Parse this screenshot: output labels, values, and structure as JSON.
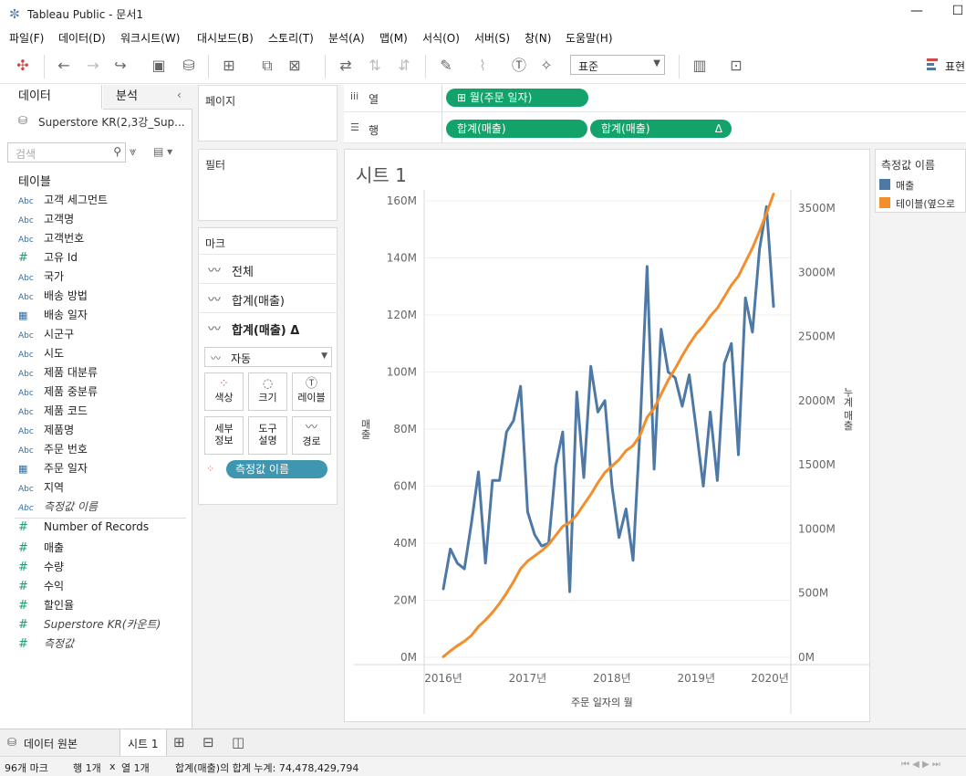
{
  "window": {
    "title": "Tableau Public - 문서1",
    "minimize": "—",
    "maximize": "☐"
  },
  "menu": [
    "파일(F)",
    "데이터(D)",
    "워크시트(W)",
    "대시보드(B)",
    "스토리(T)",
    "분석(A)",
    "맵(M)",
    "서식(O)",
    "서버(S)",
    "창(N)",
    "도움말(H)"
  ],
  "toolbar": {
    "fit_value": "표준",
    "show_me": "표현"
  },
  "data_pane": {
    "tab_data": "데이터",
    "tab_analysis": "분석",
    "datasource": "Superstore KR(2,3강_Sup...",
    "search_placeholder": "검색",
    "tables_header": "테이블",
    "dimensions": [
      {
        "type": "Abc",
        "name": "고객 세그먼트"
      },
      {
        "type": "Abc",
        "name": "고객명"
      },
      {
        "type": "Abc",
        "name": "고객번호"
      },
      {
        "type": "#",
        "name": "고유 Id"
      },
      {
        "type": "Abc",
        "name": "국가"
      },
      {
        "type": "Abc",
        "name": "배송 방법"
      },
      {
        "type": "cal",
        "name": "배송 일자"
      },
      {
        "type": "Abc",
        "name": "시군구"
      },
      {
        "type": "Abc",
        "name": "시도"
      },
      {
        "type": "Abc",
        "name": "제품 대분류"
      },
      {
        "type": "Abc",
        "name": "제품 중분류"
      },
      {
        "type": "Abc",
        "name": "제품 코드"
      },
      {
        "type": "Abc",
        "name": "제품명"
      },
      {
        "type": "Abc",
        "name": "주문 번호"
      },
      {
        "type": "cal",
        "name": "주문 일자"
      },
      {
        "type": "Abc",
        "name": "지역"
      },
      {
        "type": "Abc",
        "name": "측정값 이름",
        "italic": true
      }
    ],
    "measures": [
      {
        "type": "#",
        "name": "Number of Records"
      },
      {
        "type": "#",
        "name": "매출"
      },
      {
        "type": "#",
        "name": "수량"
      },
      {
        "type": "#",
        "name": "수익"
      },
      {
        "type": "#",
        "name": "할인율"
      },
      {
        "type": "#",
        "name": "Superstore KR(카운트)",
        "italic": true
      },
      {
        "type": "#",
        "name": "측정값",
        "italic": true
      }
    ]
  },
  "cards": {
    "pages": "페이지",
    "filters": "필터",
    "marks": "마크",
    "marks_rows": [
      "전체",
      "합계(매출)",
      "합계(매출) Δ"
    ],
    "mark_type": "자동",
    "mark_buttons": [
      "색상",
      "크기",
      "레이블",
      "세부\n정보",
      "도구\n설명",
      "경로"
    ],
    "mark_pill": "측정값 이름"
  },
  "shelves": {
    "columns_label": "열",
    "rows_label": "행",
    "columns_pill": "월(주문 일자)",
    "rows_pill_1": "합계(매출)",
    "rows_pill_2": "합계(매출)",
    "rows_pill_2_delta": "Δ"
  },
  "sheet": {
    "title": "시트 1",
    "xaxis_title": "주문 일자의 월",
    "left_axis_title": "매출",
    "right_axis_title": "누계 매출"
  },
  "legend": {
    "title": "측정값 이름",
    "items": [
      "매출",
      "테이블(옆으로"
    ]
  },
  "tabs": {
    "datasource": "데이터 원본",
    "sheet": "시트 1"
  },
  "status": {
    "marks": "96개 마크",
    "rows": "행 1개",
    "x": "x",
    "cols": "열 1개",
    "sum": "합계(매출)의 합계 누계: 74,478,429,794"
  },
  "colors": {
    "sales": "#4e79a7",
    "running": "#f28e2b",
    "pill": "#13a36a",
    "mark_pill": "#3e96b0"
  },
  "chart_data": {
    "type": "line",
    "x_ticks": [
      "2016년",
      "2017년",
      "2018년",
      "2019년",
      "2020년"
    ],
    "left_ticks": [
      "0M",
      "20M",
      "40M",
      "60M",
      "80M",
      "100M",
      "120M",
      "140M",
      "160M"
    ],
    "right_ticks": [
      "0M",
      "500M",
      "1000M",
      "1500M",
      "2000M",
      "2500M",
      "3000M",
      "3500M"
    ],
    "left_ylim": [
      0,
      160
    ],
    "right_ylim": [
      0,
      3500
    ],
    "series": [
      {
        "name": "매출",
        "axis": "left",
        "color": "#4e79a7",
        "values": [
          24,
          38,
          33,
          31,
          47,
          65,
          33,
          62,
          62,
          79,
          83,
          95,
          51,
          43,
          39,
          40,
          67,
          79,
          23,
          93,
          63,
          102,
          86,
          90,
          60,
          42,
          52,
          34,
          80,
          137,
          66,
          115,
          100,
          98,
          88,
          99,
          80,
          60,
          86,
          62,
          103,
          110,
          71,
          126,
          114,
          143,
          158,
          123
        ]
      },
      {
        "name": "합계(매출) Δ",
        "axis": "right",
        "color": "#f28e2b",
        "values": [
          5,
          50,
          90,
          125,
          170,
          240,
          290,
          350,
          420,
          500,
          590,
          690,
          750,
          790,
          830,
          880,
          950,
          1020,
          1050,
          1110,
          1190,
          1270,
          1360,
          1440,
          1490,
          1540,
          1610,
          1650,
          1730,
          1870,
          1940,
          2050,
          2160,
          2250,
          2350,
          2440,
          2520,
          2580,
          2660,
          2720,
          2810,
          2900,
          2970,
          3080,
          3190,
          3320,
          3460,
          3610
        ]
      }
    ]
  }
}
